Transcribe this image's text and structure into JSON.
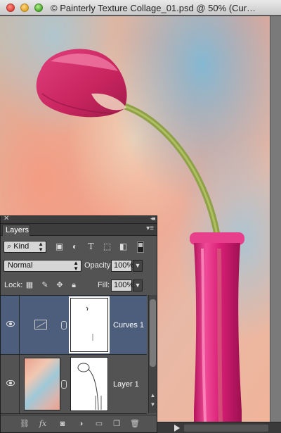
{
  "window": {
    "title": "© Painterly Texture Collage_01.psd @ 50% (Cur…"
  },
  "layers_panel": {
    "close_glyph": "✕",
    "collapse_glyph": "◂◂",
    "tab_label": "Layers",
    "menu_glyph": "▾≡",
    "filter": {
      "kind_label": "Kind",
      "icons": [
        "image-filter-icon",
        "adjustment-filter-icon",
        "type-filter-icon",
        "shape-filter-icon",
        "smart-object-filter-icon"
      ]
    },
    "blend_mode": "Normal",
    "opacity_label": "Opacity:",
    "opacity_value": "100%",
    "lock_label": "Lock:",
    "fill_label": "Fill:",
    "fill_value": "100%",
    "layers": [
      {
        "name": "Curves 1",
        "type": "adjustment",
        "selected": true,
        "visible": true
      },
      {
        "name": "Layer 1",
        "type": "pixel",
        "selected": false,
        "visible": true
      }
    ],
    "bottom_icons": [
      "link-layers-icon",
      "fx-icon",
      "add-mask-icon",
      "new-adjustment-icon",
      "new-group-icon",
      "new-layer-icon",
      "delete-layer-icon"
    ]
  },
  "colors": {
    "panel_bg": "#535353",
    "selected_row": "#4d5e7c",
    "tulip": "#d6306e",
    "vase": "#e0247a"
  }
}
